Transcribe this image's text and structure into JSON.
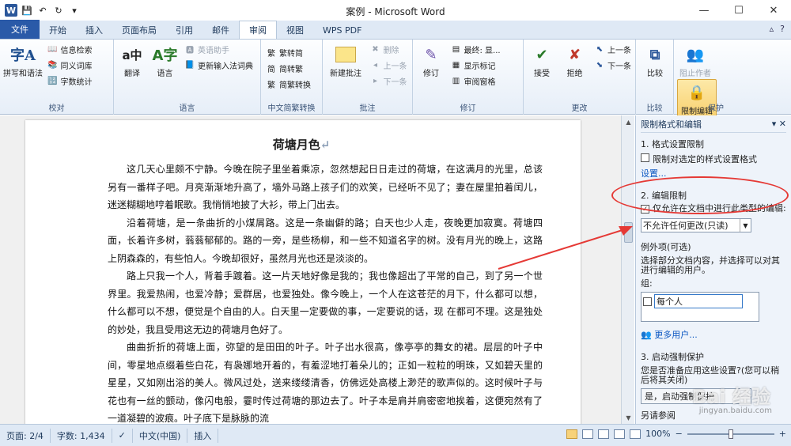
{
  "window": {
    "title": "案例 - Microsoft Word",
    "minimize": "—",
    "maximize": "☐",
    "close": "✕"
  },
  "qat": {
    "logo": "W",
    "save": "💾",
    "undo": "↶",
    "redo": "↻",
    "more": "▾"
  },
  "tabs": [
    {
      "label": "文件"
    },
    {
      "label": "开始"
    },
    {
      "label": "插入"
    },
    {
      "label": "页面布局"
    },
    {
      "label": "引用"
    },
    {
      "label": "邮件"
    },
    {
      "label": "审阅"
    },
    {
      "label": "视图"
    },
    {
      "label": "WPS PDF"
    }
  ],
  "tabs_right": {
    "collapse": "▵",
    "help": "?"
  },
  "ribbon": {
    "proofing": {
      "label": "校对",
      "spell": "拼写和语法",
      "research": "信息检索",
      "thesaurus": "同义词库",
      "wordcount": "字数统计"
    },
    "language": {
      "label": "语言",
      "translate": "翻译",
      "language": "语言",
      "ime_assist": "英语助手",
      "update_ime": "更新输入法词典"
    },
    "chinese": {
      "label": "中文简繁转换",
      "to_trad": "繁转简",
      "to_simp": "简转繁",
      "convert": "简繁转换"
    },
    "comments": {
      "label": "批注",
      "new": "新建批注",
      "delete": "删除",
      "prev": "上一条",
      "next": "下一条"
    },
    "tracking": {
      "label": "修订",
      "track": "修订",
      "display": "最终: 显...",
      "show_markup": "显示标记",
      "pane": "审阅窗格"
    },
    "changes": {
      "label": "更改",
      "accept": "接受",
      "reject": "拒绝",
      "prev": "上一条",
      "next": "下一条"
    },
    "compare": {
      "label": "比较",
      "compare": "比较"
    },
    "protect": {
      "label": "保护",
      "block_authors": "阻止作者",
      "restrict": "限制编辑"
    }
  },
  "document": {
    "title": "荷塘月色",
    "paragraphs": [
      "这几天心里颇不宁静。今晚在院子里坐着乘凉，忽然想起日日走过的荷塘，在这满月的光里，总该另有一番样子吧。月亮渐渐地升高了，墙外马路上孩子们的欢笑，已经听不见了；妻在屋里拍着闰儿，迷迷糊糊地哼着眠歌。我悄悄地披了大衫，带上门出去。",
      "沿着荷塘，是一条曲折的小煤屑路。这是一条幽僻的路；白天也少人走，夜晚更加寂寞。荷塘四面，长着许多树，蓊蓊郁郁的。路的一旁，是些杨柳，和一些不知道名字的树。没有月光的晚上，这路上阴森森的，有些怕人。今晚却很好，虽然月光也还是淡淡的。",
      "路上只我一个人，背着手踱着。这一片天地好像是我的；我也像超出了平常的自己，到了另一个世界里。我爱热闹，也爱冷静；爱群居，也爱独处。像今晚上，一个人在这苍茫的月下，什么都可以想，什么都可以不想，便觉是个自由的人。白天里一定要做的事，一定要说的话，现 在都可不理。这是独处的妙处，我且受用这无边的荷塘月色好了。",
      "曲曲折折的荷塘上面，弥望的是田田的叶子。叶子出水很高，像亭亭的舞女的裙。层层的叶子中间，零星地点缀着些白花，有袅娜地开着的，有羞涩地打着朵儿的；正如一粒粒的明珠，又如碧天里的星星，又如刚出浴的美人。微风过处，送来缕缕清香，仿佛远处高楼上渺茫的歌声似的。这时候叶子与花也有一丝的颤动，像闪电般，霎时传过荷塘的那边去了。叶子本是肩并肩密密地挨着，这便宛然有了一道凝碧的波痕。叶子底下是脉脉的流"
    ],
    "para_mark": "↵"
  },
  "pane": {
    "title": "限制格式和编辑",
    "sec1": "1. 格式设置限制",
    "sec1_check": "限制对选定的样式设置格式",
    "sec1_link": "设置...",
    "sec2": "2. 编辑限制",
    "sec2_check": "仅允许在文档中进行此类型的编辑:",
    "dropdown": "不允许任何更改(只读)",
    "exceptions": "例外项(可选)",
    "exceptions_desc": "选择部分文档内容，并选择可以对其进行编辑的用户。",
    "group_label": "组:",
    "group_item": "每个人",
    "more_users": "更多用户...",
    "sec3": "3. 启动强制保护",
    "sec3_desc": "您是否准备应用这些设置?(您可以稍后将其关闭)",
    "sec3_btn": "是，启动强制保护",
    "see_also": "另请参阅"
  },
  "status": {
    "page": "页面: 2/4",
    "words": "字数: 1,434",
    "lang": "中文(中国)",
    "mode": "插入",
    "zoom": "100%",
    "minus": "−",
    "plus": "+"
  },
  "watermark": {
    "text": "Bai 经验",
    "sub": "jingyan.baidu.com"
  },
  "colors": {
    "file_tab": "#2a5aa8",
    "accent": "#2b579a",
    "annotation": "#e53935"
  }
}
